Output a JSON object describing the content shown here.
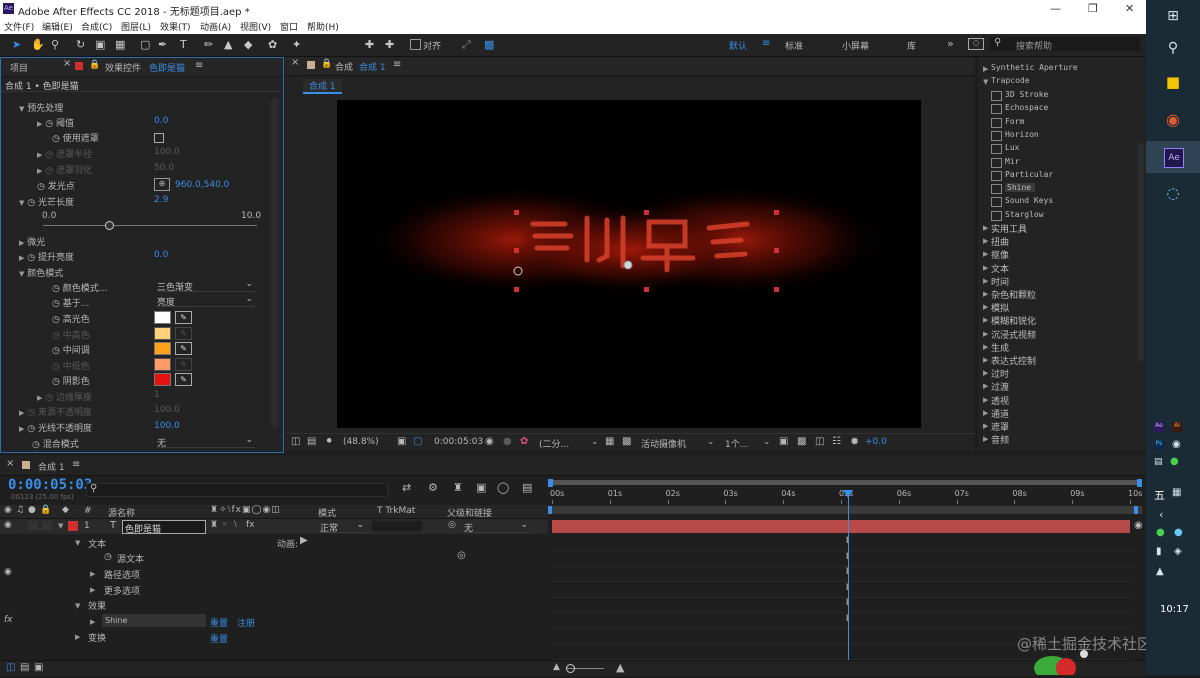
{
  "window": {
    "title": "Adobe After Effects CC 2018 - 无标题项目.aep *",
    "app_icon": "Ae"
  },
  "menu": [
    "文件(F)",
    "编辑(E)",
    "合成(C)",
    "图层(L)",
    "效果(T)",
    "动画(A)",
    "视图(V)",
    "窗口",
    "帮助(H)"
  ],
  "toolbar": {
    "snap_label": "对齐",
    "workspaces": [
      "默认",
      "标准",
      "小屏幕",
      "库"
    ],
    "search_placeholder": "搜索帮助"
  },
  "left_panel": {
    "tab_project": "项目",
    "tab_effects": "效果控件",
    "tab_effects_layer": "色即是猫",
    "breadcrumb": "合成 1 • 色即是猫",
    "props": {
      "preprocess": "预先处理",
      "threshold": "阈值",
      "threshold_val": "0.0",
      "use_mask": "使用遮罩",
      "mask_radius": "遮罩半径",
      "mask_radius_val": "100.0",
      "mask_feather": "遮罩羽化",
      "mask_feather_val": "50.0",
      "source_point": "发光点",
      "source_point_val": "960.0,540.0",
      "ray_length": "光芒长度",
      "ray_length_val": "2.9",
      "slider_min": "0.0",
      "slider_max": "10.0",
      "shimmer": "微光",
      "boost_light": "提升亮度",
      "boost_light_val": "0.0",
      "colorize": "颜色模式",
      "colorize_mode": "颜色模式...",
      "colorize_mode_val": "三色渐变",
      "base_on": "基于...",
      "base_on_val": "亮度",
      "highlights": "高光色",
      "mid_high": "中高色",
      "midtones": "中间调",
      "mid_low": "中低色",
      "shadows": "阴影色",
      "edge_thickness": "边缘厚度",
      "edge_thickness_val": "1",
      "source_opacity": "来源不透明度",
      "source_opacity_val": "100.0",
      "shine_opacity": "光线不透明度",
      "shine_opacity_val": "100.0",
      "transfer_mode": "混合模式",
      "transfer_mode_val": "无"
    },
    "colors": {
      "highlights": "#ffffff",
      "mid_high": "#ffd27a",
      "midtones": "#ffa11a",
      "mid_low": "#ff9966",
      "shadows": "#e41111"
    }
  },
  "comp_panel": {
    "tab_prefix": "合成",
    "tab_name": "合成 1",
    "subtab": "合成 1",
    "footer": {
      "zoom": "(48.8%)",
      "timecode": "0:00:05:03",
      "resolution": "(二分...",
      "camera": "活动摄像机",
      "views": "1个...",
      "exposure": "+0.0"
    }
  },
  "effects_panel": {
    "top_group": "Synthetic Aperture",
    "open_group": "Trapcode",
    "items": [
      "3D Stroke",
      "Echospace",
      "Form",
      "Horizon",
      "Lux",
      "Mir",
      "Particular",
      "Shine",
      "Sound Keys",
      "Starglow"
    ],
    "selected": "Shine",
    "categories": [
      "实用工具",
      "扭曲",
      "抠像",
      "文本",
      "时间",
      "杂色和颗粒",
      "模拟",
      "模糊和锐化",
      "沉浸式视频",
      "生成",
      "表达式控制",
      "过时",
      "过渡",
      "透视",
      "通道",
      "遮罩",
      "音频"
    ]
  },
  "timeline": {
    "tab": "合成 1",
    "timecode": "0:00:05:03",
    "frames": "00123 (25.00 fps)",
    "search_placeholder": "",
    "columns": {
      "source_name": "源名称",
      "mode": "模式",
      "trkmat": "T TrkMat",
      "parent": "父级和链接"
    },
    "layer": {
      "num": "1",
      "type": "T",
      "name": "色即是猫",
      "mode": "正常",
      "parent": "无"
    },
    "tree": {
      "text": "文本",
      "animate": "动画:",
      "source_text": "源文本",
      "path_options": "路径选项",
      "more_options": "更多选项",
      "effects": "效果",
      "effect_name": "Shine",
      "reset": "重置",
      "register": "注册",
      "transform": "变换",
      "transform_reset": "重置"
    },
    "ruler": [
      "00s",
      "01s",
      "02s",
      "03s",
      "04s",
      "05s",
      "06s",
      "07s",
      "08s",
      "09s",
      "10s"
    ],
    "playhead_seconds": 5.12,
    "duration_seconds": 10
  },
  "taskbar": {
    "clock": "10:17",
    "ime": "五"
  },
  "watermark": "@稀土掘金技术社区"
}
